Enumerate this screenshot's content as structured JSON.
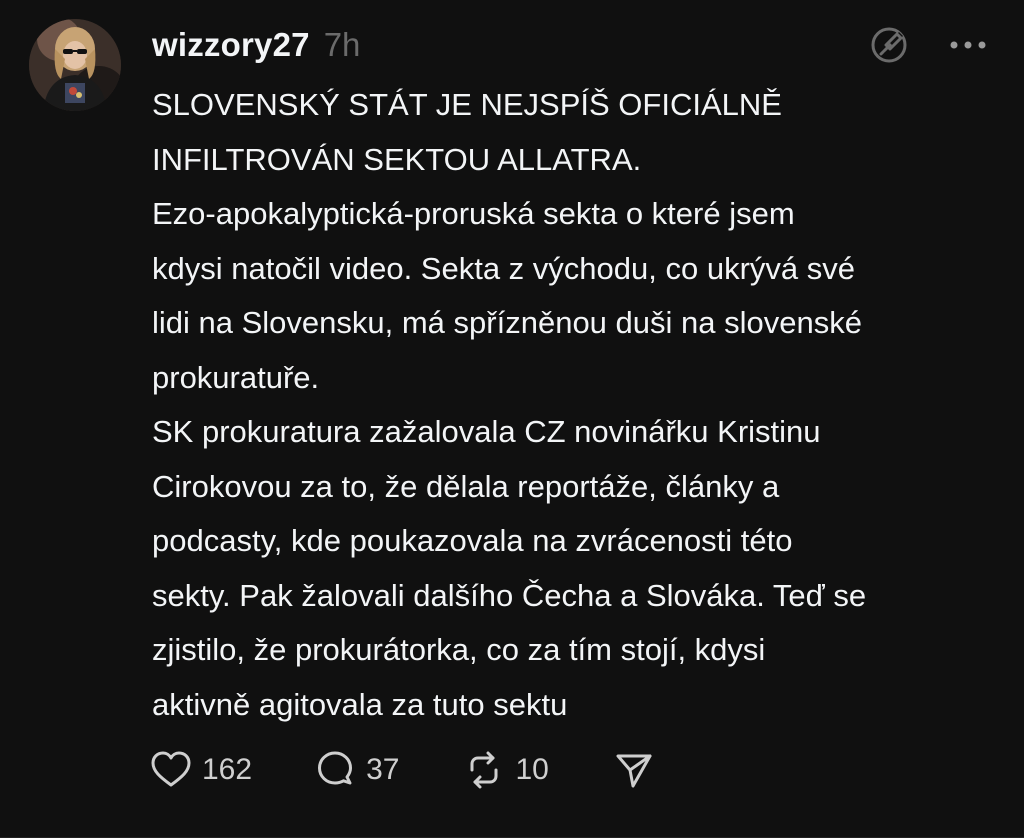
{
  "post": {
    "username": "wizzory27",
    "time": "7h",
    "lines": [
      "SLOVENSKÝ STÁT JE NEJSPÍŠ OFICIÁLNĚ",
      "INFILTROVÁN SEKTOU ALLATRA.",
      "Ezo-apokalyptická-proruská sekta o které jsem",
      "kdysi natočil video. Sekta z východu, co ukrývá své",
      "lidi na Slovensku, má spřízněnou duši na slovenské",
      "prokuratuře.",
      "SK prokuratura zažalovala CZ novinářku Kristinu",
      "Cirokovou za to, že dělala reportáže, články a",
      "podcasty, kde poukazovala na zvrácenosti této",
      "sekty. Pak žalovali dalšího Čecha a Slováka. Teď se",
      "zjistilo, že prokurátorka, co za tím stojí, kdysi",
      "aktivně agitovala za tuto sektu"
    ]
  },
  "actions": {
    "likes": "162",
    "replies": "37",
    "reposts": "10"
  },
  "icons": {
    "avatar": "avatar",
    "ai_edit": "edit-circle-icon",
    "more": "more-dots-icon",
    "like": "heart-icon",
    "reply": "comment-icon",
    "repost": "repost-icon",
    "share": "send-icon"
  },
  "colors": {
    "background": "#101010",
    "text": "#f3f5f7",
    "muted": "#6b6b6b"
  }
}
